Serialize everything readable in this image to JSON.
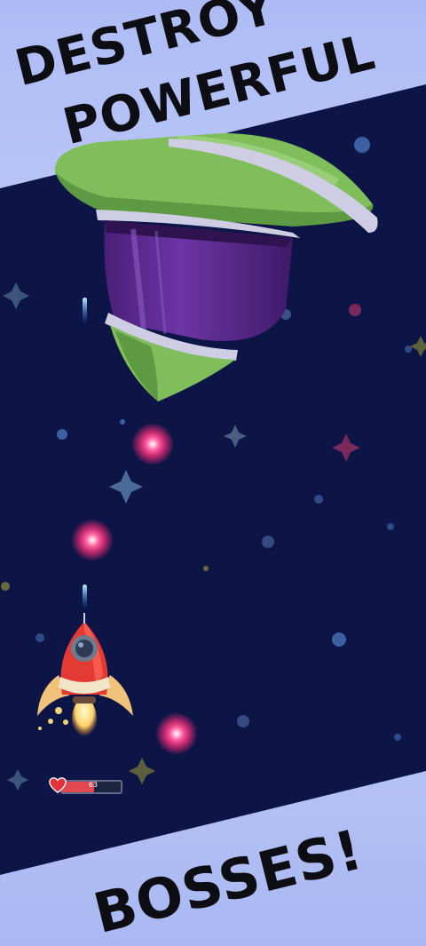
{
  "banner": {
    "line1": "DESTROY",
    "line2": "POWERFUL",
    "line3": "BOSSES!"
  },
  "hud": {
    "health_value": "63",
    "health_fraction": 0.55
  },
  "colors": {
    "space": "#0d1446",
    "frame": "#b7c4f8",
    "boss_green": "#7fbe5b",
    "boss_purple": "#5b2a8c",
    "bullet_pink": "#ff3d7a",
    "laser_blue": "#4fc3ff",
    "rocket_red": "#e33b33"
  },
  "icons": [
    "heart-icon",
    "boss-ship",
    "player-rocket",
    "enemy-bullet",
    "player-laser"
  ]
}
